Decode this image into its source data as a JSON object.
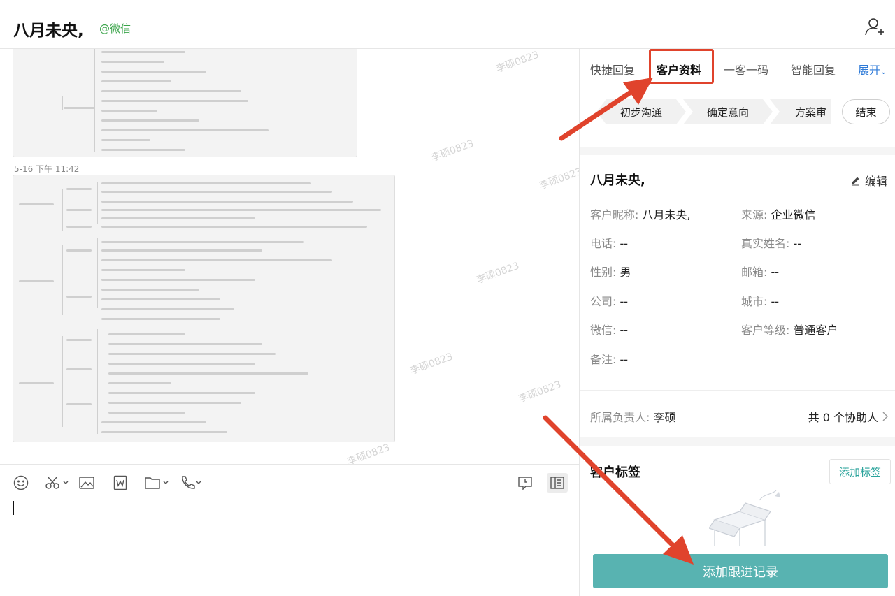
{
  "header": {
    "title": "八月未央,",
    "source": "@微信"
  },
  "chat": {
    "message_time": "5-16 下午 11:42",
    "watermark": "李硕0823"
  },
  "panel": {
    "tabs": [
      {
        "label": "快捷回复"
      },
      {
        "label": "客户资料"
      },
      {
        "label": "一客一码"
      },
      {
        "label": "智能回复"
      }
    ],
    "expand_label": "展开",
    "stages": [
      "初步沟通",
      "确定意向",
      "方案审"
    ],
    "end_label": "结束",
    "customer_name": "八月未央,",
    "edit_label": "编辑",
    "fields": {
      "nickname": {
        "k": "客户昵称",
        "v": "八月未央,"
      },
      "source": {
        "k": "来源",
        "v": "企业微信"
      },
      "phone": {
        "k": "电话",
        "v": "--"
      },
      "realname": {
        "k": "真实姓名",
        "v": "--"
      },
      "gender": {
        "k": "性别",
        "v": "男"
      },
      "email": {
        "k": "邮箱",
        "v": "--"
      },
      "company": {
        "k": "公司",
        "v": "--"
      },
      "city": {
        "k": "城市",
        "v": "--"
      },
      "wechat": {
        "k": "微信",
        "v": "--"
      },
      "level": {
        "k": "客户等级",
        "v": "普通客户"
      },
      "remark": {
        "k": "备注",
        "v": "--"
      }
    },
    "owner_label": "所属负责人",
    "owner_value": "李硕",
    "helpers": "共 0 个协助人",
    "tags_title": "客户标签",
    "add_tag_label": "添加标签",
    "followup_label": "添加跟进记录"
  },
  "colors": {
    "accent_teal": "#58b3b1",
    "highlight_red": "#e0432c",
    "link_blue": "#2f7bd8",
    "wechat_green": "#3aa44a"
  }
}
